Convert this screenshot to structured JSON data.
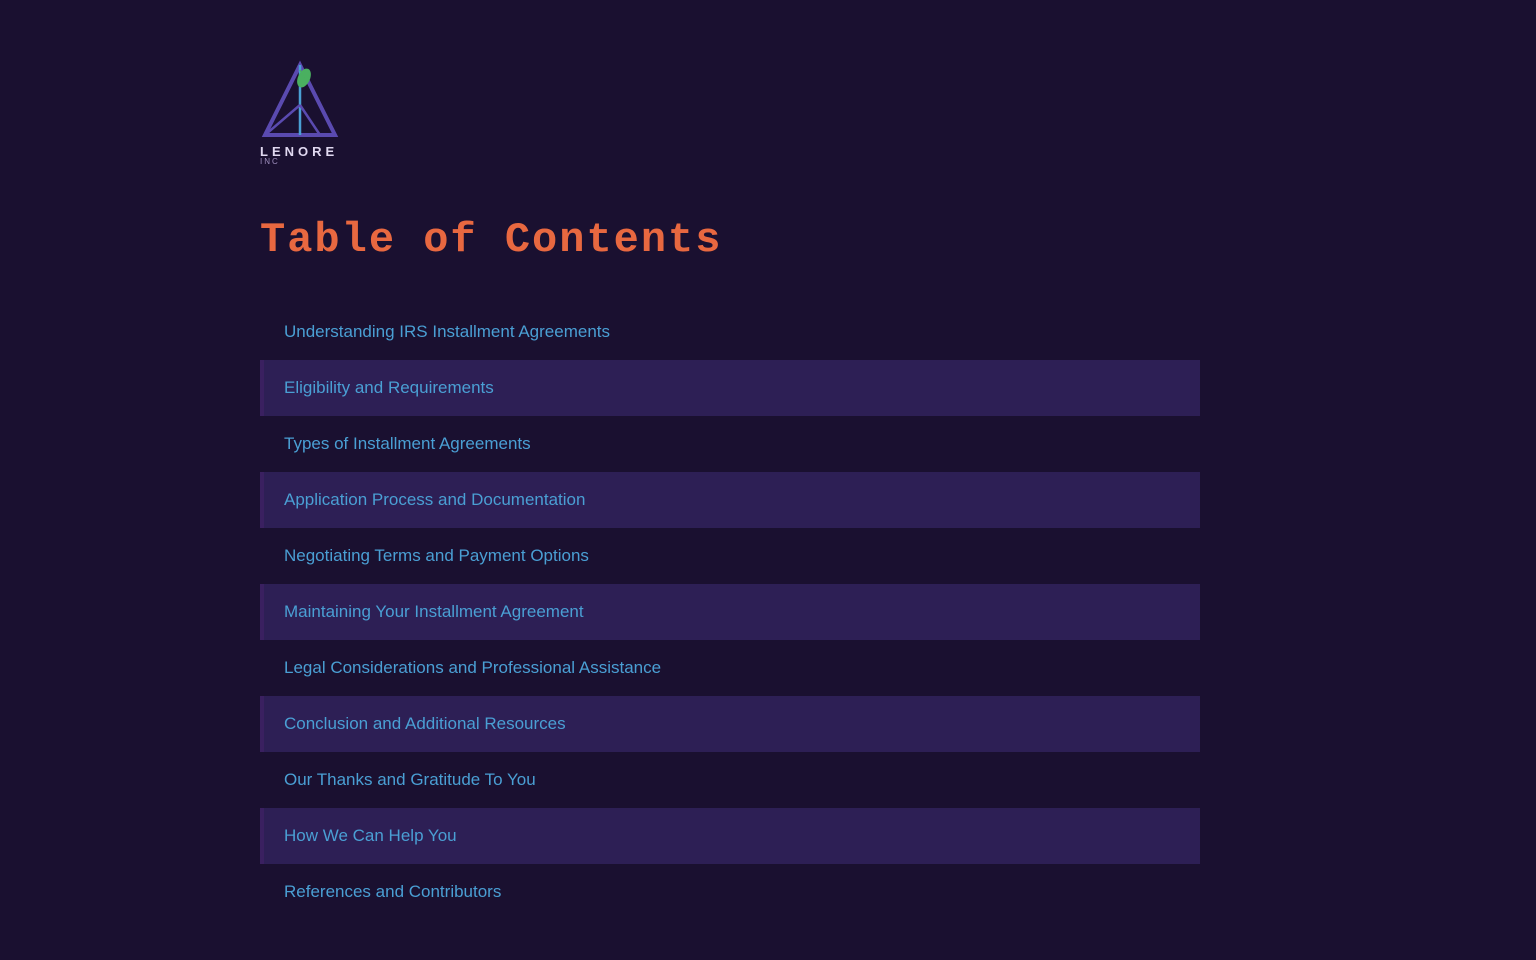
{
  "logo": {
    "text": "LENORE",
    "subtext": "INC"
  },
  "toc": {
    "title": "Table of Contents",
    "items": [
      {
        "id": "item-1",
        "label": "Understanding IRS Installment Agreements",
        "highlighted": false
      },
      {
        "id": "item-2",
        "label": "Eligibility and Requirements",
        "highlighted": true
      },
      {
        "id": "item-3",
        "label": "Types of Installment Agreements",
        "highlighted": false
      },
      {
        "id": "item-4",
        "label": "Application Process and Documentation",
        "highlighted": true
      },
      {
        "id": "item-5",
        "label": "Negotiating Terms and Payment Options",
        "highlighted": false
      },
      {
        "id": "item-6",
        "label": "Maintaining Your Installment Agreement",
        "highlighted": true
      },
      {
        "id": "item-7",
        "label": "Legal Considerations and Professional Assistance",
        "highlighted": false
      },
      {
        "id": "item-8",
        "label": "Conclusion and Additional Resources",
        "highlighted": true
      },
      {
        "id": "item-9",
        "label": "Our Thanks and Gratitude To You",
        "highlighted": false
      },
      {
        "id": "item-10",
        "label": "How We Can Help You",
        "highlighted": true
      },
      {
        "id": "item-11",
        "label": "References and Contributors",
        "highlighted": false
      }
    ]
  },
  "colors": {
    "background": "#1a1030",
    "title": "#e86840",
    "link": "#4a9fd4",
    "row_highlight": "#2d1f55"
  }
}
